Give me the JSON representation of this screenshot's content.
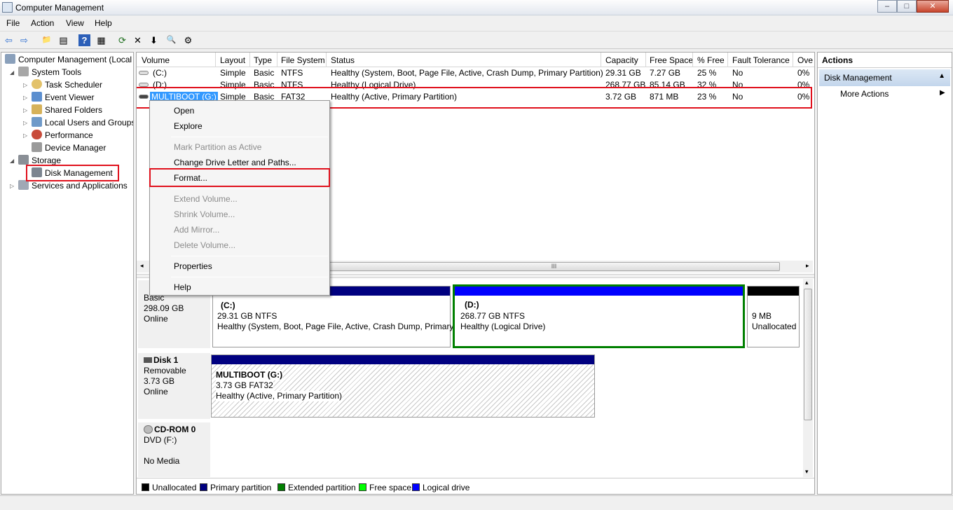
{
  "window": {
    "title": "Computer Management",
    "buttons": [
      "–",
      "□",
      "✕"
    ]
  },
  "menu": [
    "File",
    "Action",
    "View",
    "Help"
  ],
  "toolbar": {
    "icons": [
      "back-icon",
      "forward-icon",
      "up-folder-icon",
      "show-hide-tree-icon",
      "help-icon",
      "properties-icon",
      "refresh-icon",
      "delete-icon",
      "export-icon",
      "search-icon",
      "settings-icon"
    ],
    "glyphs": [
      "⇦",
      "⇨",
      "📁",
      "▤",
      "?",
      "▦",
      "⟳",
      "✕",
      "⬇",
      "🔍",
      "⚙"
    ]
  },
  "tree": {
    "root": "Computer Management (Local",
    "system_tools": "System Tools",
    "task_scheduler": "Task Scheduler",
    "event_viewer": "Event Viewer",
    "shared_folders": "Shared Folders",
    "local_users": "Local Users and Groups",
    "performance": "Performance",
    "device_manager": "Device Manager",
    "storage": "Storage",
    "disk_management": "Disk Management",
    "services": "Services and Applications"
  },
  "columns": [
    "Volume",
    "Layout",
    "Type",
    "File System",
    "Status",
    "Capacity",
    "Free Space",
    "% Free",
    "Fault Tolerance",
    "Ove"
  ],
  "volumes": [
    {
      "volume": "(C:)",
      "layout": "Simple",
      "type": "Basic",
      "fs": "NTFS",
      "status": "Healthy (System, Boot, Page File, Active, Crash Dump, Primary Partition)",
      "capacity": "29.31 GB",
      "free": "7.27 GB",
      "pct": "25 %",
      "fault": "No",
      "over": "0%"
    },
    {
      "volume": "(D:)",
      "layout": "Simple",
      "type": "Basic",
      "fs": "NTFS",
      "status": "Healthy (Logical Drive)",
      "capacity": "268.77 GB",
      "free": "85.14 GB",
      "pct": "32 %",
      "fault": "No",
      "over": "0%"
    },
    {
      "volume": "MULTIBOOT (G:)",
      "layout": "Simple",
      "type": "Basic",
      "fs": "FAT32",
      "status": "Healthy (Active, Primary Partition)",
      "capacity": "3.72 GB",
      "free": "871 MB",
      "pct": "23 %",
      "fault": "No",
      "over": "0%"
    }
  ],
  "hscroll_grip": "III",
  "disks": {
    "disk0": {
      "type": "Basic",
      "size": "298.09 GB",
      "state": "Online"
    },
    "disk1": {
      "name": "Disk 1",
      "type": "Removable",
      "size": "3.73 GB",
      "state": "Online"
    },
    "cdrom": {
      "name": "CD-ROM 0",
      "type": "DVD (F:)",
      "state": "No Media"
    }
  },
  "partitions": {
    "c": {
      "name": "(C:)",
      "size": "29.31 GB NTFS",
      "status": "Healthy (System, Boot, Page File, Active, Crash Dump, Primary"
    },
    "d": {
      "name": "(D:)",
      "size": "268.77 GB NTFS",
      "status": "Healthy (Logical Drive)"
    },
    "unalloc": {
      "size": "9 MB",
      "label": "Unallocated"
    },
    "g": {
      "name": "MULTIBOOT  (G:)",
      "size": "3.73 GB FAT32",
      "status": "Healthy (Active, Primary Partition)"
    }
  },
  "legend": [
    {
      "label": "Unallocated",
      "color": "#000000"
    },
    {
      "label": "Primary partition",
      "color": "#000080"
    },
    {
      "label": "Extended partition",
      "color": "#008000"
    },
    {
      "label": "Free space",
      "color": "#00ff00"
    },
    {
      "label": "Logical drive",
      "color": "#0000ff"
    }
  ],
  "context_menu": {
    "open": "Open",
    "explore": "Explore",
    "mark_active": "Mark Partition as Active",
    "change_letter": "Change Drive Letter and Paths...",
    "format": "Format...",
    "extend": "Extend Volume...",
    "shrink": "Shrink Volume...",
    "mirror": "Add Mirror...",
    "delete": "Delete Volume...",
    "properties": "Properties",
    "help": "Help"
  },
  "actions": {
    "title": "Actions",
    "section": "Disk Management",
    "more": "More Actions"
  },
  "colors": {
    "highlight": "#e0101c",
    "primary": "#000080",
    "logical": "#0000ff",
    "extended": "#008000",
    "selection": "#3399ff"
  }
}
